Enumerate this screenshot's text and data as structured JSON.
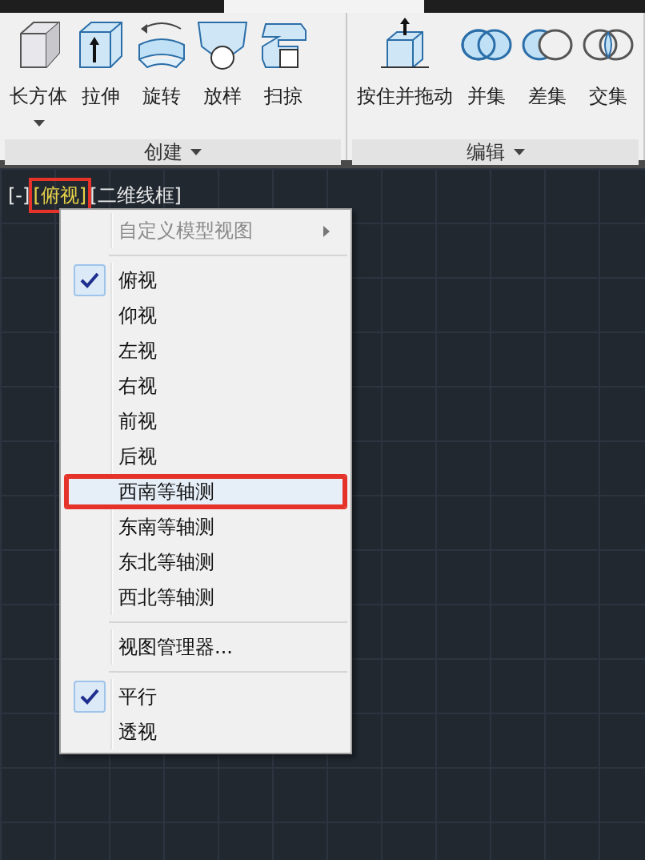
{
  "ribbon": {
    "panels": [
      {
        "title": "创建",
        "tools": [
          {
            "label": "长方体",
            "kind": "box",
            "dropdown": true
          },
          {
            "label": "拉伸",
            "kind": "extrude",
            "dropdown": false
          },
          {
            "label": "旋转",
            "kind": "revolve",
            "dropdown": false
          },
          {
            "label": "放样",
            "kind": "loft",
            "dropdown": false
          },
          {
            "label": "扫掠",
            "kind": "sweep",
            "dropdown": false
          }
        ]
      },
      {
        "title": "编辑",
        "tools": [
          {
            "label": "按住并拖动",
            "kind": "presspull",
            "dropdown": false
          },
          {
            "label": "并集",
            "kind": "union",
            "dropdown": false
          },
          {
            "label": "差集",
            "kind": "subtract",
            "dropdown": false
          },
          {
            "label": "交集",
            "kind": "intersect",
            "dropdown": false
          }
        ]
      }
    ]
  },
  "viewport_label": {
    "parts": [
      {
        "text": "[-]",
        "annotated": false
      },
      {
        "text": "[俯视]",
        "annotated": true
      },
      {
        "text": "[二维线框]",
        "annotated": false
      }
    ]
  },
  "context_menu": {
    "items": [
      {
        "kind": "submenu",
        "label": "自定义模型视图",
        "disabled": true
      },
      {
        "kind": "separator"
      },
      {
        "kind": "item",
        "label": "俯视",
        "checked": true,
        "selected": false,
        "annotated": false
      },
      {
        "kind": "item",
        "label": "仰视",
        "checked": false,
        "selected": false,
        "annotated": false
      },
      {
        "kind": "item",
        "label": "左视",
        "checked": false,
        "selected": false,
        "annotated": false
      },
      {
        "kind": "item",
        "label": "右视",
        "checked": false,
        "selected": false,
        "annotated": false
      },
      {
        "kind": "item",
        "label": "前视",
        "checked": false,
        "selected": false,
        "annotated": false
      },
      {
        "kind": "item",
        "label": "后视",
        "checked": false,
        "selected": false,
        "annotated": false
      },
      {
        "kind": "item",
        "label": "西南等轴测",
        "checked": false,
        "selected": true,
        "annotated": true
      },
      {
        "kind": "item",
        "label": "东南等轴测",
        "checked": false,
        "selected": false,
        "annotated": false
      },
      {
        "kind": "item",
        "label": "东北等轴测",
        "checked": false,
        "selected": false,
        "annotated": false
      },
      {
        "kind": "item",
        "label": "西北等轴测",
        "checked": false,
        "selected": false,
        "annotated": false
      },
      {
        "kind": "separator"
      },
      {
        "kind": "item",
        "label": "视图管理器...",
        "checked": false,
        "selected": false,
        "annotated": false
      },
      {
        "kind": "separator"
      },
      {
        "kind": "item",
        "label": "平行",
        "checked": true,
        "selected": false,
        "annotated": false
      },
      {
        "kind": "item",
        "label": "透视",
        "checked": false,
        "selected": false,
        "annotated": false
      }
    ]
  }
}
